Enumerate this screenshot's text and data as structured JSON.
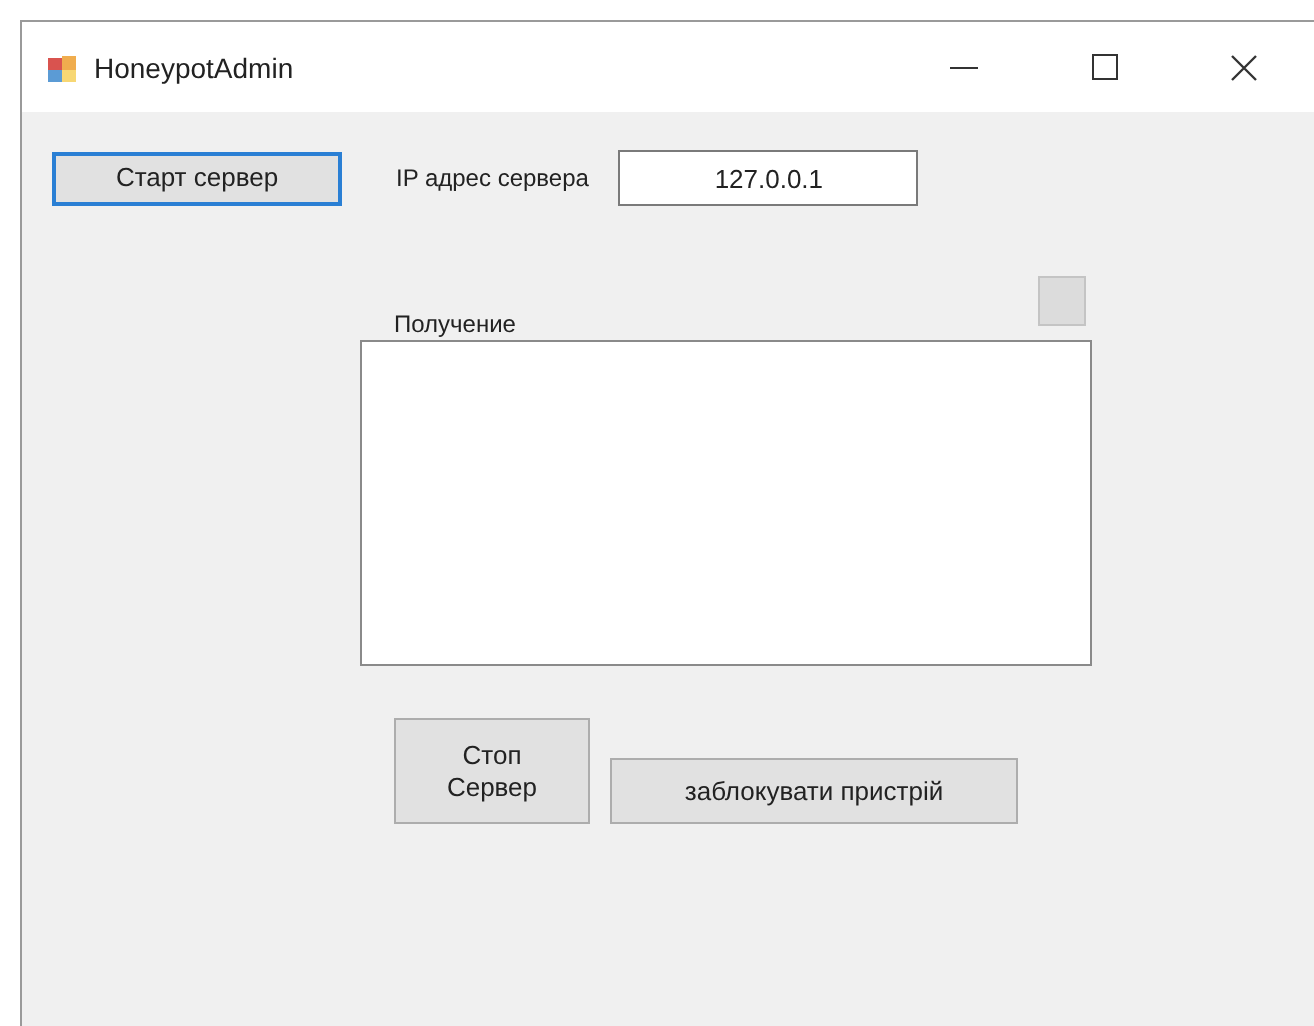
{
  "window": {
    "title": "HoneypotAdmin"
  },
  "start_button": "Старт сервер",
  "server_ip": {
    "label": "IP адрес сервера",
    "value": "127.0.0.1"
  },
  "receive": {
    "label": "Получение"
  },
  "stop_button": "Стоп\nСервер",
  "block_button": "заблокувати пристрій"
}
